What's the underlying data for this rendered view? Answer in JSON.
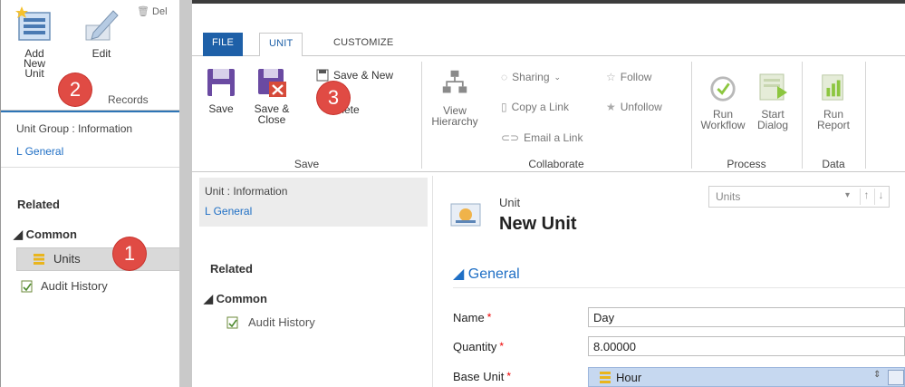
{
  "background_window": {
    "ribbon": {
      "add_new_unit": "Add New\nUnit",
      "edit": "Edit",
      "delete_truncated": "Del",
      "group_records": "Records"
    },
    "nav": {
      "title": "Unit Group : Information",
      "general": "L General",
      "related": "Related",
      "common": "◢ Common",
      "units": "Units",
      "audit_history": "Audit History"
    }
  },
  "front_window": {
    "tabs": {
      "file": "FILE",
      "unit": "UNIT",
      "customize": "CUSTOMIZE"
    },
    "ribbon": {
      "save": "Save",
      "save_close": "Save &\nClose",
      "save_new": "Save & New",
      "delete": "Delete",
      "group_save": "Save",
      "view_hierarchy": "View\nHierarchy",
      "sharing": "Sharing",
      "copy_link": "Copy a Link",
      "email_link": "Email a Link",
      "follow": "Follow",
      "unfollow": "Unfollow",
      "group_collaborate": "Collaborate",
      "run_workflow": "Run\nWorkflow",
      "start_dialog": "Start\nDialog",
      "group_process": "Process",
      "run_report": "Run\nReport",
      "group_data": "Data"
    },
    "nav": {
      "title": "Unit : Information",
      "general": "L General",
      "related": "Related",
      "common": "◢ Common",
      "audit_history": "Audit History"
    },
    "form": {
      "entity": "Unit",
      "title": "New Unit",
      "units_select": "Units",
      "section": "◢ General",
      "name_label": "Name",
      "name_value": "Day",
      "quantity_label": "Quantity",
      "quantity_value": "8.00000",
      "base_unit_label": "Base Unit",
      "base_unit_value": "Hour",
      "required_mark": "*"
    }
  },
  "callouts": [
    "1",
    "2",
    "3"
  ],
  "colors": {
    "file_tab": "#1e60a8",
    "link_blue": "#1f6fc5",
    "callout": "#e04b44",
    "lookup_bg": "#c6d8f0"
  }
}
